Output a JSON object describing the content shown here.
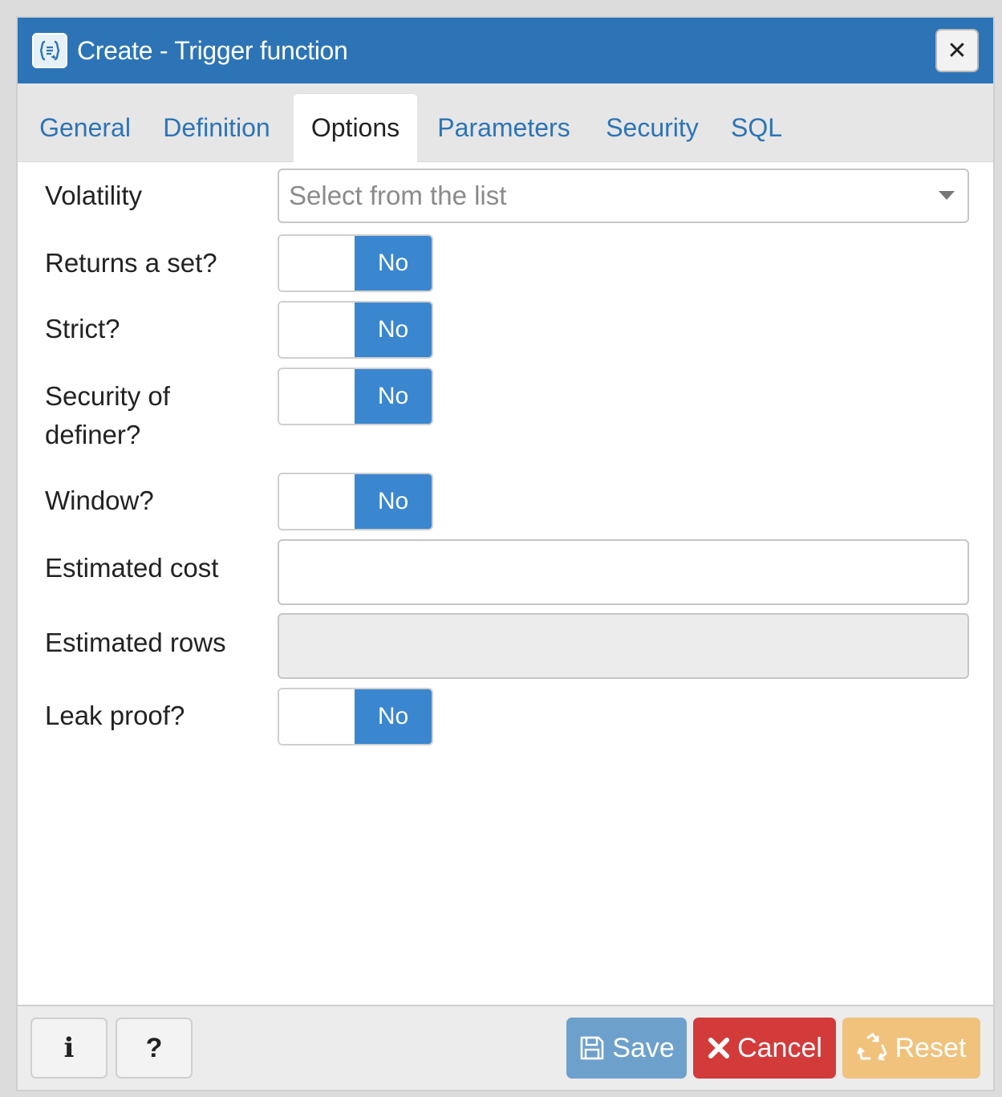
{
  "window": {
    "title": "Create - Trigger function",
    "icon": "trigger-function-icon",
    "close_icon": "close-icon",
    "close_glyph": "✕"
  },
  "tabs": [
    {
      "label": "General",
      "active": false
    },
    {
      "label": "Definition",
      "active": false
    },
    {
      "label": "Options",
      "active": true
    },
    {
      "label": "Parameters",
      "active": false
    },
    {
      "label": "Security",
      "active": false
    },
    {
      "label": "SQL",
      "active": false
    }
  ],
  "form": {
    "volatility": {
      "label": "Volatility",
      "placeholder": "Select from the list",
      "value": ""
    },
    "returns_set": {
      "label": "Returns a set?",
      "state": "No"
    },
    "strict": {
      "label": "Strict?",
      "state": "No"
    },
    "security_definer": {
      "label_line1": "Security of",
      "label_line2": "definer?",
      "state": "No"
    },
    "window": {
      "label": "Window?",
      "state": "No"
    },
    "estimated_cost": {
      "label": "Estimated cost",
      "value": ""
    },
    "estimated_rows": {
      "label": "Estimated rows",
      "value": "",
      "disabled": true
    },
    "leak_proof": {
      "label": "Leak proof?",
      "state": "No"
    }
  },
  "footer": {
    "info_glyph": "i",
    "help_glyph": "?",
    "save_label": "Save",
    "cancel_label": "Cancel",
    "reset_label": "Reset",
    "save_icon": "floppy-disk-icon",
    "cancel_icon": "x-icon",
    "reset_icon": "recycle-icon"
  },
  "colors": {
    "titlebar": "#2c74b6",
    "toggle_on": "#3a86cf",
    "save": "#6ea0cc",
    "cancel": "#d23b3a",
    "reset": "#f0c27c"
  }
}
